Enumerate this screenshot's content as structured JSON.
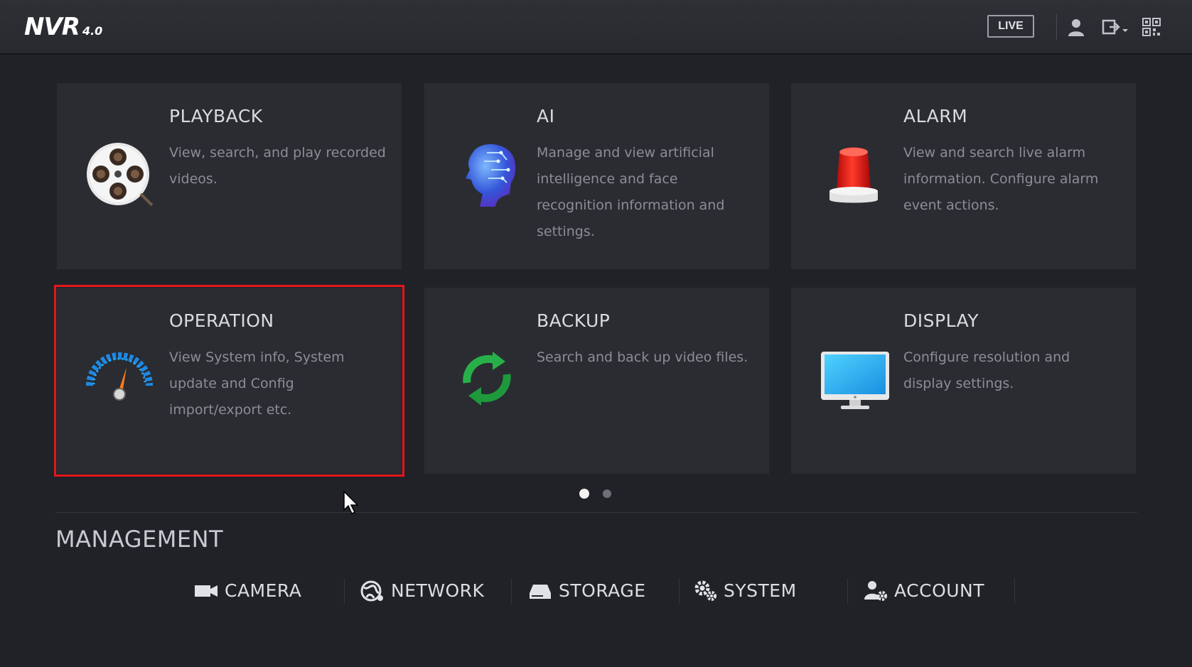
{
  "header": {
    "logo_text": "NVR",
    "logo_version": "4.0",
    "live_label": "LIVE",
    "icons": [
      "user-icon",
      "logout-icon",
      "qr-code-icon"
    ]
  },
  "cards": [
    {
      "title": "PLAYBACK",
      "description": "View, search, and play recorded videos.",
      "icon": "film-reel-icon",
      "selected": false
    },
    {
      "title": "AI",
      "description": "Manage and view artificial intelligence and face recognition information and settings.",
      "icon": "ai-brain-head-icon",
      "selected": false
    },
    {
      "title": "ALARM",
      "description": "View and search live alarm information. Configure alarm event actions.",
      "icon": "alarm-siren-icon",
      "selected": false
    },
    {
      "title": "OPERATION",
      "description": "View System info, System update and Config import/export etc.",
      "icon": "gauge-icon",
      "selected": true
    },
    {
      "title": "BACKUP",
      "description": "Search and back up video files.",
      "icon": "sync-arrows-icon",
      "selected": false
    },
    {
      "title": "DISPLAY",
      "description": "Configure resolution and display settings.",
      "icon": "monitor-icon",
      "selected": false
    }
  ],
  "pager": {
    "current_page": 1,
    "total_pages": 2
  },
  "management": {
    "title": "MANAGEMENT",
    "items": [
      {
        "label": "CAMERA",
        "icon": "camera-icon"
      },
      {
        "label": "NETWORK",
        "icon": "network-globe-icon"
      },
      {
        "label": "STORAGE",
        "icon": "hard-drive-icon"
      },
      {
        "label": "SYSTEM",
        "icon": "gears-icon"
      },
      {
        "label": "ACCOUNT",
        "icon": "account-gear-icon"
      }
    ]
  },
  "colors": {
    "selection": "#e4161a",
    "background": "#202227",
    "card": "#2a2c31"
  }
}
